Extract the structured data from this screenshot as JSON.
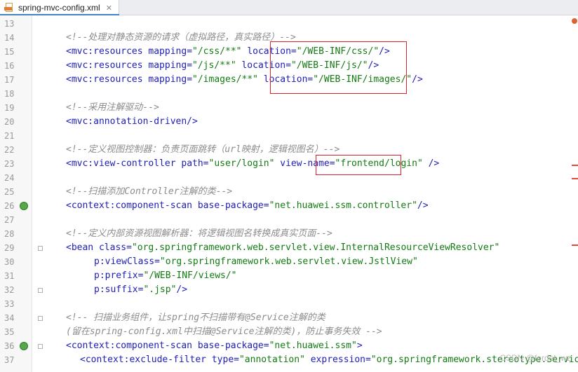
{
  "tab": {
    "filename": "spring-mvc-config.xml",
    "close_glyph": "✕"
  },
  "gutter_icons": [
    "bean-gutter-icon"
  ],
  "lines": [
    {
      "num": "13",
      "segments": []
    },
    {
      "num": "14",
      "segments": [
        {
          "c": "cm",
          "t": "<!--处理对静态资源的请求（虚拟路径，真实路径）-->"
        }
      ]
    },
    {
      "num": "15",
      "segments": [
        {
          "c": "t",
          "t": "<mvc:resources "
        },
        {
          "c": "a",
          "t": "mapping="
        },
        {
          "c": "v",
          "t": "\"/css/**\""
        },
        {
          "c": "s",
          "t": " "
        },
        {
          "c": "a",
          "t": "location="
        },
        {
          "c": "v",
          "t": "\"/WEB-INF/css/\""
        },
        {
          "c": "t",
          "t": "/>"
        }
      ]
    },
    {
      "num": "16",
      "segments": [
        {
          "c": "t",
          "t": "<mvc:resources "
        },
        {
          "c": "a",
          "t": "mapping="
        },
        {
          "c": "v",
          "t": "\"/js/**\""
        },
        {
          "c": "s",
          "t": " "
        },
        {
          "c": "a",
          "t": "location="
        },
        {
          "c": "v",
          "t": "\"/WEB-INF/js/\""
        },
        {
          "c": "t",
          "t": "/>"
        }
      ]
    },
    {
      "num": "17",
      "segments": [
        {
          "c": "t",
          "t": "<mvc:resources "
        },
        {
          "c": "a",
          "t": "mapping="
        },
        {
          "c": "v",
          "t": "\"/images/**\""
        },
        {
          "c": "s",
          "t": " "
        },
        {
          "c": "a",
          "t": "location="
        },
        {
          "c": "v",
          "t": "\"/WEB-INF/images/\""
        },
        {
          "c": "t",
          "t": "/>"
        }
      ]
    },
    {
      "num": "18",
      "segments": []
    },
    {
      "num": "19",
      "segments": [
        {
          "c": "cm",
          "t": "<!--采用注解驱动-->"
        }
      ]
    },
    {
      "num": "20",
      "segments": [
        {
          "c": "t",
          "t": "<mvc:annotation-driven/>"
        }
      ]
    },
    {
      "num": "21",
      "segments": []
    },
    {
      "num": "22",
      "segments": [
        {
          "c": "cm",
          "t": "<!--定义视图控制器：负责页面跳转（url映射，逻辑视图名）-->"
        }
      ]
    },
    {
      "num": "23",
      "segments": [
        {
          "c": "t",
          "t": "<mvc:view-controller "
        },
        {
          "c": "a",
          "t": "path="
        },
        {
          "c": "v",
          "t": "\"user/login\""
        },
        {
          "c": "s",
          "t": " "
        },
        {
          "c": "a",
          "t": "view-name="
        },
        {
          "c": "v",
          "t": "\"frontend/login\""
        },
        {
          "c": "s",
          "t": " "
        },
        {
          "c": "t",
          "t": "/>"
        }
      ]
    },
    {
      "num": "24",
      "segments": []
    },
    {
      "num": "25",
      "segments": [
        {
          "c": "cm",
          "t": "<!--扫描添加Controller注解的类-->"
        }
      ]
    },
    {
      "num": "26",
      "icon": true,
      "segments": [
        {
          "c": "t",
          "t": "<context:component-scan "
        },
        {
          "c": "a",
          "t": "base-package="
        },
        {
          "c": "v",
          "t": "\"net.huawei.ssm.controller\""
        },
        {
          "c": "t",
          "t": "/>"
        }
      ]
    },
    {
      "num": "27",
      "segments": []
    },
    {
      "num": "28",
      "segments": [
        {
          "c": "cm",
          "t": "<!--定义内部资源视图解析器：将逻辑视图名转换成真实页面-->"
        }
      ]
    },
    {
      "num": "29",
      "fold": true,
      "segments": [
        {
          "c": "t",
          "t": "<bean "
        },
        {
          "c": "a",
          "t": "class="
        },
        {
          "c": "v",
          "t": "\"org.springframework.web.servlet.view.InternalResourceViewResolver\""
        }
      ]
    },
    {
      "num": "30",
      "indent": 2,
      "segments": [
        {
          "c": "a",
          "t": "p:viewClass="
        },
        {
          "c": "v",
          "t": "\"org.springframework.web.servlet.view.JstlView\""
        }
      ]
    },
    {
      "num": "31",
      "indent": 2,
      "segments": [
        {
          "c": "a",
          "t": "p:prefix="
        },
        {
          "c": "v",
          "t": "\"/WEB-INF/views/\""
        }
      ]
    },
    {
      "num": "32",
      "indent": 2,
      "fold": true,
      "segments": [
        {
          "c": "a",
          "t": "p:suffix="
        },
        {
          "c": "v",
          "t": "\".jsp\""
        },
        {
          "c": "t",
          "t": "/>"
        }
      ]
    },
    {
      "num": "33",
      "segments": []
    },
    {
      "num": "34",
      "fold": true,
      "segments": [
        {
          "c": "cm",
          "t": "<!-- 扫描业务组件，让spring不扫描带有@Service注解的类"
        }
      ]
    },
    {
      "num": "35",
      "segments": [
        {
          "c": "cm",
          "t": "(留在spring-config.xml中扫描@Service注解的类)，防止事务失效 -->"
        }
      ]
    },
    {
      "num": "36",
      "icon": true,
      "fold": true,
      "segments": [
        {
          "c": "t",
          "t": "<context:component-scan "
        },
        {
          "c": "a",
          "t": "base-package="
        },
        {
          "c": "v",
          "t": "\"net.huawei.ssm\""
        },
        {
          "c": "t",
          "t": ">"
        }
      ]
    },
    {
      "num": "37",
      "indent": 1,
      "segments": [
        {
          "c": "t",
          "t": "<context:exclude-filter "
        },
        {
          "c": "a",
          "t": "type="
        },
        {
          "c": "v",
          "t": "\"annotation\""
        },
        {
          "c": "s",
          "t": " "
        },
        {
          "c": "a",
          "t": "expression="
        },
        {
          "c": "v",
          "t": "\"org.springframework.stereotype.Service\""
        },
        {
          "c": "t",
          "t": "/>"
        }
      ]
    }
  ],
  "watermark": "CSDN @fordet_wz",
  "colors": {
    "highlight_box": "#e0202a",
    "tag": "#1d1db8",
    "value": "#127b12",
    "comment": "#8c8c8c"
  }
}
